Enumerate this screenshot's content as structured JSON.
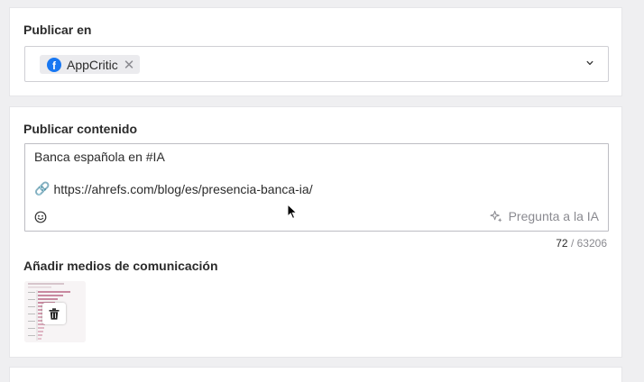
{
  "publish_in": {
    "label": "Publicar en",
    "selected": [
      {
        "network": "facebook",
        "name": "AppCritic",
        "icon": "facebook-icon"
      }
    ],
    "remove_glyph": "✕"
  },
  "content": {
    "label": "Publicar contenido",
    "line1": "Banca española en #IA",
    "line2": "https://ahrefs.com/blog/es/presencia-banca-ia/",
    "link_emoji": "🔗",
    "ai_label": "Pregunta a la IA",
    "counter_current": "72",
    "counter_sep": "/",
    "counter_max": "63206"
  },
  "media": {
    "label": "Añadir medios de comunicación"
  },
  "colors": {
    "facebook": "#1877f2",
    "chart_bars": "#c98aa1"
  }
}
